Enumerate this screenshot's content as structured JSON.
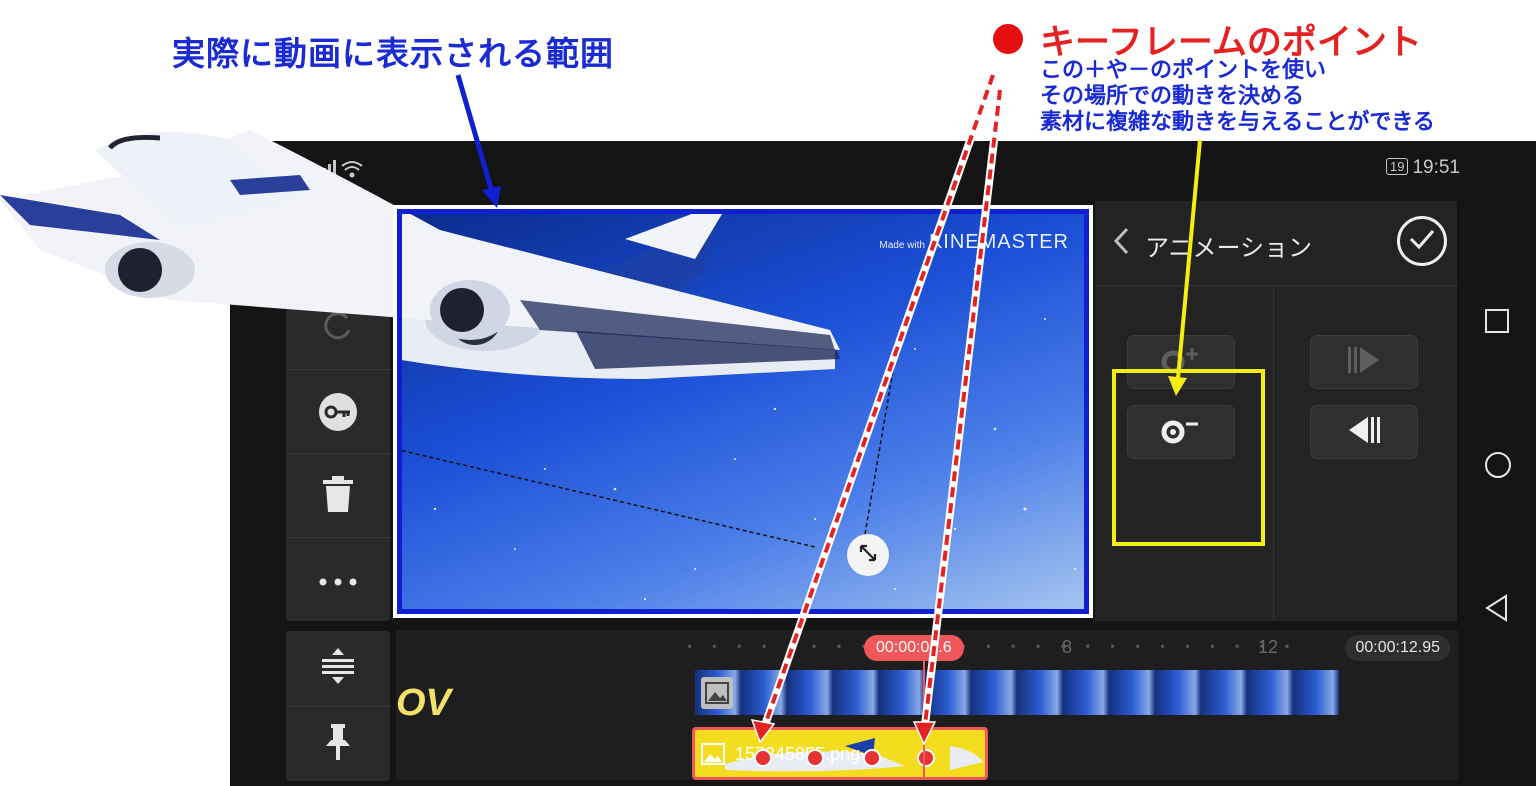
{
  "annotations": {
    "title": "実際に動画に表示される範囲",
    "keyframe_title": "キーフレームのポイント",
    "keyframe_notes": [
      "この＋や－のポイントを使い",
      "その場所での動きを決める",
      "素材に複雑な動きを与えることができる"
    ],
    "colors": {
      "blue": "#1a2bd4",
      "red": "#e52222",
      "yellow": "#f4ee10"
    }
  },
  "status_bar": {
    "signal_icon": "signal-wifi-icon",
    "battery": "19",
    "time": "19:51"
  },
  "toolbar": {
    "items": [
      {
        "icon": "undo-icon"
      },
      {
        "icon": "keyframe-key-icon"
      },
      {
        "icon": "trash-icon"
      },
      {
        "icon": "more-dots-icon"
      }
    ],
    "bottom_items": [
      {
        "icon": "expand-tracks-icon"
      },
      {
        "icon": "pin-icon"
      }
    ]
  },
  "preview": {
    "watermark_small": "Made with",
    "watermark_brand": "KINEMASTER"
  },
  "panel": {
    "title": "アニメーション",
    "buttons": [
      "add-keyframe-icon",
      "remove-keyframe-icon",
      "next-keyframe-icon",
      "previous-keyframe-icon"
    ]
  },
  "timeline": {
    "current_time": "00:00:04.6",
    "end_time": "00:00:12.95",
    "tick_labels": [
      "8",
      "12"
    ],
    "layer_name": "157245855.png",
    "layer_logo": "OV"
  },
  "nav_bar": {
    "icons": [
      "recent-apps-icon",
      "home-icon",
      "back-icon"
    ]
  }
}
